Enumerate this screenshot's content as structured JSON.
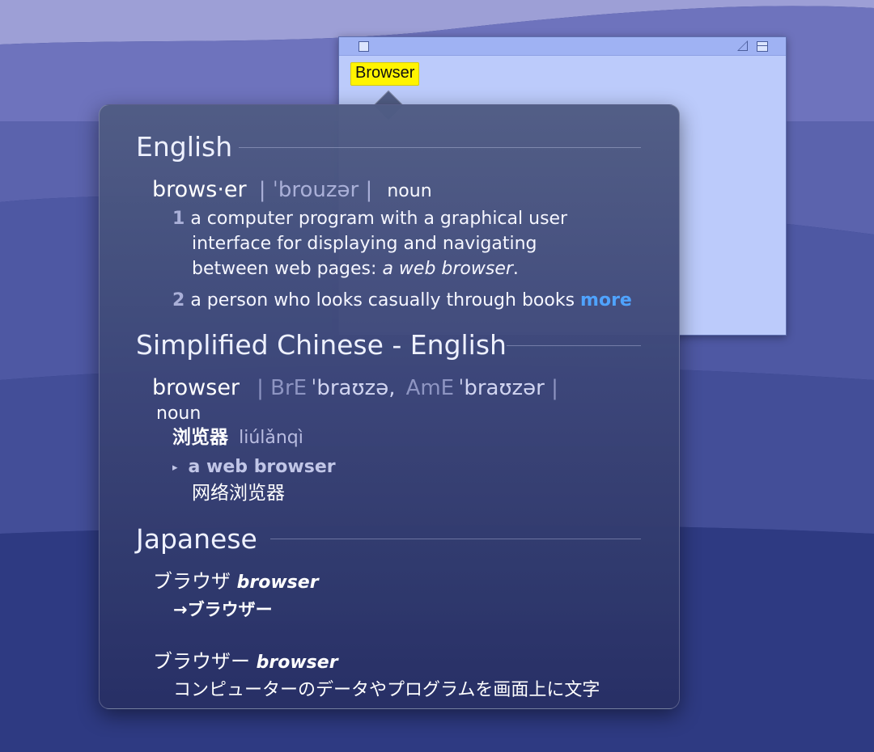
{
  "sticky_note": {
    "selected_word": "Browser"
  },
  "dictionary": {
    "english": {
      "section_title": "English",
      "headword": "brows·er",
      "pronunciation": "| ˈbrouzər |",
      "part_of_speech": "noun",
      "definitions": [
        {
          "number": "1",
          "lines": [
            "a computer program with a graphical user",
            "interface for displaying and navigating",
            "between web pages: "
          ],
          "example": "a web browser",
          "end": "."
        },
        {
          "number": "2",
          "text": "a person who looks casually through books",
          "more_label": "more"
        }
      ]
    },
    "chinese": {
      "section_title": "Simplified Chinese - English",
      "headword": "browser",
      "pron_bar_left": "| ",
      "bre_label": "BrE",
      "bre_ipa": "ˈbraʊzə,",
      "ame_label": "AmE",
      "ame_ipa": "ˈbraʊzər",
      "pron_bar_right": " |",
      "part_of_speech": "noun",
      "translation": "浏览器",
      "pinyin": "liúlǎnqì",
      "example_marker": "▸",
      "example_en": "a web browser",
      "example_zh": "网络浏览器"
    },
    "japanese": {
      "section_title": "Japanese",
      "entries": [
        {
          "kana": "ブラウザ",
          "roman": "browser",
          "cross_ref": "→ブラウザー"
        },
        {
          "kana": "ブラウザー",
          "roman": "browser",
          "definition": "コンピューターのデータやプログラムを画面上に文字"
        }
      ]
    }
  },
  "colors": {
    "highlight": "#fff400",
    "link": "#4fa3ff",
    "sticky": "#bccbfb"
  }
}
